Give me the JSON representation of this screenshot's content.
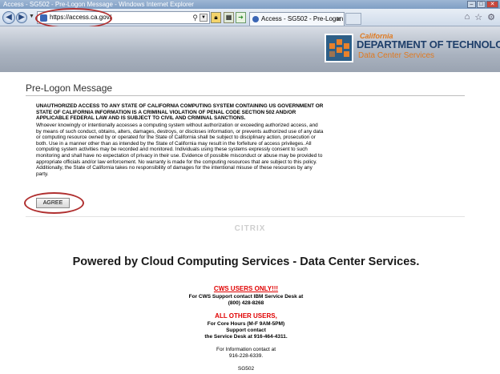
{
  "browser": {
    "window_title": "Access - SG502 - Pre-Logon Message - Windows Internet Explorer",
    "url": "https://access.ca.gov/",
    "tab_title": "Access - SG502 - Pre-Logon ...",
    "icons": [
      "back-icon",
      "forward-icon",
      "search-icon",
      "lock-icon",
      "compatibility-icon",
      "go-icon",
      "home-icon",
      "favorites-icon",
      "tools-icon"
    ]
  },
  "header": {
    "logo_california": "California",
    "logo_department": "DEPARTMENT OF TECHNOLOGY",
    "logo_subtitle": "Data Center Services"
  },
  "prelogon": {
    "title": "Pre-Logon Message",
    "warning_bold": "UNAUTHORIZED ACCESS TO ANY STATE OF CALIFORNIA COMPUTING SYSTEM CONTAINING US GOVERNMENT OR STATE OF CALIFORNIA INFORMATION IS A CRIMINAL VIOLATION OF PENAL CODE SECTION 502 AND/OR APPLICABLE FEDERAL LAW AND IS SUBJECT TO CIVIL AND CRIMINAL SANCTIONS.",
    "warning_body": "Whoever knowingly or intentionally accesses a computing system without authorization or exceeding authorized access, and by means of such conduct, obtains, alters, damages, destroys, or discloses information, or prevents authorized use of any data or computing resource owned by or operated for the State of California shall be subject to disciplinary action, prosecution or both. Use in a manner other than as intended by the State of California may result in the forfeiture of access privileges. All computing system activities may be recorded and monitored. Individuals using these systems expressly consent to such monitoring and shall have no expectation of privacy in their use. Evidence of possible misconduct or abuse may be provided to appropriate officials and/or law enforcement. No warranty is made for the computing resources that are subject to this policy. Additionally, the State of California takes no responsibility of damages for the intentional misuse of these resources by any party.",
    "agree_label": "AGREE"
  },
  "footer": {
    "citrix": "CITRIX",
    "powered_by": "Powered by Cloud Computing Services - Data Center Services.",
    "cws_title": "CWS USERS ONLY!!!",
    "cws_line1": "For CWS Support contact IBM Service Desk at",
    "cws_phone": "(800) 428-8268",
    "other_title": "ALL OTHER USERS,",
    "other_line1": "For Core Hours (M-F 9AM-5PM)",
    "other_line2": "Support contact",
    "other_line3": "the Service Desk at 916-464-4311.",
    "info_line1": "For Information contact at",
    "info_phone": "916-228-6339.",
    "server_id": "SG502"
  },
  "colors": {
    "annotation_oval": "#b03030",
    "cws_red": "#e00000",
    "logo_blue": "#1f3f6a",
    "logo_orange": "#e07a20"
  }
}
